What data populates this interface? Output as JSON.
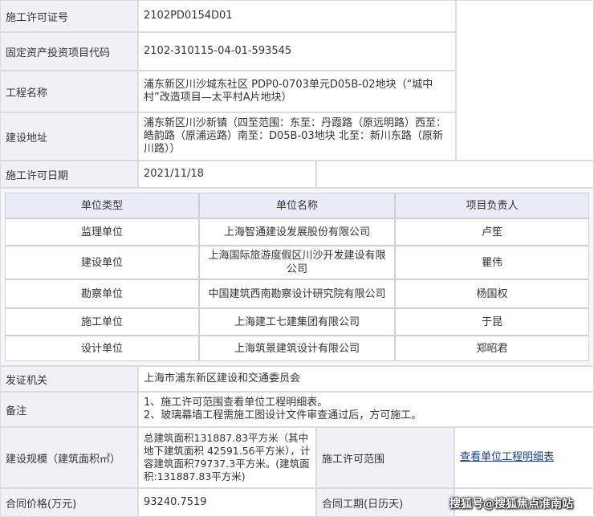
{
  "permit": {
    "number_label": "施工许可证号",
    "number_value": "2102PD0154D01",
    "code_label": "固定资产投资项目代码",
    "code_value": "2102-310115-04-01-593545",
    "project_label": "工程名称",
    "project_value": "浦东新区川沙城东社区 PDP0-0703单元D05B-02地块（“城中村”改造项目—太平村A片地块）",
    "address_label": "建设地址",
    "address_value": "浦东新区川沙新镇（四至范围：东至：丹霞路（原远明路）西至：皓韵路（原浦运路）南至：D05B-03地块 北至：新川东路（原新川路））",
    "date_label": "施工许可日期",
    "date_value": "2021/11/18"
  },
  "units": {
    "headers": [
      "单位类型",
      "单位名称",
      "项目负责人"
    ],
    "rows": [
      {
        "type": "监理单位",
        "name": "上海智通建设发展股份有限公司",
        "leader": "卢笙"
      },
      {
        "type": "建设单位",
        "name": "上海国际旅游度假区川沙开发建设有限公司",
        "leader": "瞿伟"
      },
      {
        "type": "勘察单位",
        "name": "中国建筑西南勘察设计研究院有限公司",
        "leader": "杨国权"
      },
      {
        "type": "施工单位",
        "name": "上海建工七建集团有限公司",
        "leader": "于昆"
      },
      {
        "type": "设计单位",
        "name": "上海筑景建筑设计有限公司",
        "leader": "郑昭君"
      }
    ]
  },
  "footer": {
    "issuer_label": "发证机关",
    "issuer_value": "上海市浦东新区建设和交通委员会",
    "remarks_label": "备注",
    "remarks_line1": "1、施工许可范围查看单位工程明细表。",
    "remarks_line2": "2、玻璃幕墙工程需施工图设计文件审查通过后，方可施工。",
    "scale_label": "建设规模（建筑面积㎡）",
    "scale_value": "总建筑面积131887.83平方米（其中地下建筑面积 42591.56平方米），计容建筑面积79737.3平方米。(建筑面积:131887.83平方米)",
    "scope_label": "施工许可范围",
    "scope_link": "查看单位工程明细表",
    "price_label": "合同价格(万元)",
    "price_value": "93240.7519",
    "period_label": "合同工期(日历天)",
    "period_value": ""
  },
  "watermark": {
    "text": "搜狐号@搜狐焦点淮南站"
  }
}
